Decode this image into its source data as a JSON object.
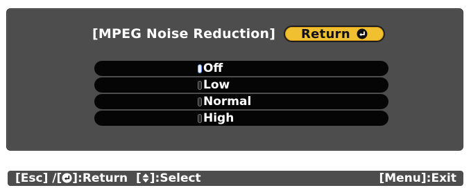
{
  "dialog": {
    "title": "[MPEG Noise Reduction]",
    "return_button": {
      "label": "Return",
      "icon": "enter-icon"
    }
  },
  "options": [
    {
      "label": "Off",
      "selected": true
    },
    {
      "label": "Low",
      "selected": false
    },
    {
      "label": "Normal",
      "selected": false
    },
    {
      "label": "High",
      "selected": false
    }
  ],
  "help_bar": {
    "esc_prefix": "[Esc] /[",
    "return_suffix": "]:Return",
    "select_prefix": "[",
    "select_suffix": "]:Select",
    "exit_label": "[Menu]:Exit",
    "enter_icon": "enter-icon",
    "updown_icon": "up-down-arrows-icon"
  },
  "colors": {
    "panel": "#4d4d4d",
    "row": "#050505",
    "return_button": "#f0c030",
    "text": "#ffffff"
  }
}
